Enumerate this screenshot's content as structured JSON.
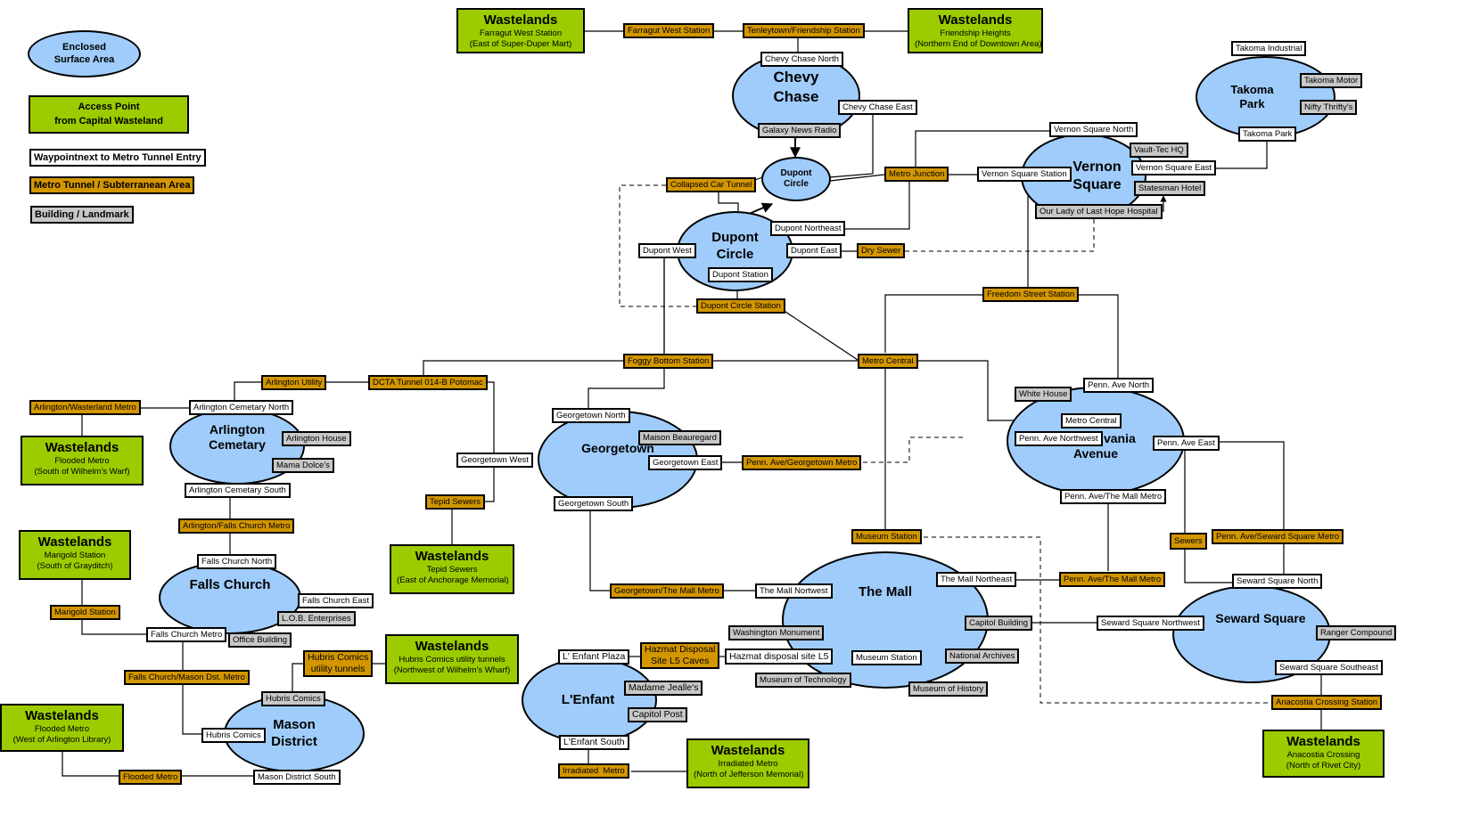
{
  "legend": {
    "enclosed": "Enclosed\nSurface Area",
    "access_title": "Access Point",
    "access_sub": "from Capital Wasteland",
    "waypoint": "Waypointnext to Metro Tunnel Entry",
    "metro": "Metro Tunnel / Subterranean Area",
    "building": "Building / Landmark"
  },
  "colors": {
    "enclosed_area": "#9fccfa",
    "access_point": "#9ccc00",
    "waypoint": "#ffffff",
    "metro_tunnel": "#d39600",
    "building": "#c8c8c8"
  },
  "areas": {
    "chevy_chase": "Chevy\nChase",
    "dupont_small": "Dupont\nCircle",
    "dupont": "Dupont\nCircle",
    "vernon": "Vernon\nSquare",
    "takoma": "Takoma\nPark",
    "arlington": "Arlington\nCemetary",
    "georgetown": "Georgetown",
    "penn": "Pennsylvania\nAvenue",
    "falls": "Falls Church",
    "mall": "The Mall",
    "mason": "Mason\nDistrict",
    "lenfant": "L'Enfant",
    "seward": "Seward Square"
  },
  "wastelands": {
    "farragut": {
      "title": "Wastelands",
      "line1": "Farragut West Station",
      "line2": "(East of Super-Duper Mart)"
    },
    "friendship": {
      "title": "Wastelands",
      "line1": "Friendship Heights",
      "line2": "(Northern End of Downtown Area)"
    },
    "flooded_arl": {
      "title": "Wastelands",
      "line1": "Flooded Metro",
      "line2": "(South of Wilhelm's Warf)"
    },
    "marigold": {
      "title": "Wastelands",
      "line1": "Marigold Station",
      "line2": "(South of Grayditch)"
    },
    "tepid": {
      "title": "Wastelands",
      "line1": "Tepid Sewers",
      "line2": "(East of Anchorage Memorial)"
    },
    "hubris": {
      "title": "Wastelands",
      "line1": "Hubris Comics utility tunnels",
      "line2": "(Northwest of Wilhelm's Wharf)"
    },
    "flooded_lib": {
      "title": "Wastelands",
      "line1": "Flooded Metro",
      "line2": "(West of Arlington Library)"
    },
    "irradiated": {
      "title": "Wastelands",
      "line1": "Irradiated Metro",
      "line2": "(North of Jefferson Memorial)"
    },
    "anacostia": {
      "title": "Wastelands",
      "line1": "Anacostia Crossing",
      "line2": "(North of Rivet City)"
    }
  },
  "metro": {
    "farragut_west": "Farragut West Station",
    "tenleytown": "Tenleytown/Friendship Station",
    "collapsed": "Collapsed Car Tunnel",
    "metro_junction": "Metro Junction",
    "dry_sewer": "Dry Sewer",
    "dupont_station": "Dupont Circle Station",
    "freedom": "Freedom Street Station",
    "foggy": "Foggy Bottom Station",
    "metro_central": "Metro Central",
    "arl_utility": "Arlington Utility",
    "dcta": "DCTA Tunnel 014-B Potomac",
    "arl_wast": "Arlington/Wasterland Metro",
    "tepid_sewers": "Tepid Sewers",
    "penn_georgetown": "Penn. Ave/Georgetown Metro",
    "arl_falls": "Arlington/Falls Church Metro",
    "marigold_station": "Marigold Station",
    "museum_station": "Museum Station",
    "georgetown_mall": "Georgetown/The Mall Metro",
    "penn_mall": "Penn. Ave/The Mall Metro",
    "sewers": "Sewers",
    "penn_seward": "Penn. Ave/Seward Square Metro",
    "hubris_tunnels": "Hubris Comics\nutility tunnels",
    "falls_mason": "Falls Church/Mason Dst. Metro",
    "hazmat_caves": "Hazmat Disposal\nSite L5 Caves",
    "flooded_metro": "Flooded Metro",
    "irradiated_metro": "Irradiated  Metro",
    "anacostia_station": "Anacostia Crossing Station"
  },
  "waypoints": {
    "cc_north": "Chevy Chase North",
    "cc_east": "Chevy Chase East",
    "dupont_northeast": "Dupont Northeast",
    "dupont_west": "Dupont West",
    "dupont_east": "Dupont East",
    "dupont_station": "Dupont Station",
    "vs_north": "Vernon Square North",
    "vs_station": "Vernon Square Station",
    "vs_east": "Vernon Square East",
    "takoma_industrial": "Takoma  Industrial",
    "takoma_park": "Takoma  Park",
    "arl_north": "Arlington Cemetary North",
    "arl_south": "Arlington Cemetary South",
    "gt_north": "Georgetown North",
    "gt_west": "Georgetown West",
    "gt_east": "Georgetown East",
    "gt_south": "Georgetown South",
    "penn_north": "Penn. Ave North",
    "penn_metro_central": "Metro Central",
    "penn_northwest": "Penn. Ave Northwest",
    "penn_east": "Penn. Ave East",
    "penn_mall_wp": "Penn. Ave/The Mall Metro",
    "fc_north": "Falls Church North",
    "fc_east": "Falls Church East",
    "fc_metro": "Falls Church Metro",
    "mall_northwest": "The Mall Nortwest",
    "mall_northeast": "The Mall Northeast",
    "mall_museum": "Museum Station",
    "hazmat_site": "Hazmat disposal site L5",
    "lenfant_plaza": "L' Enfant Plaza",
    "lenfant_south": "L'Enfant South",
    "md_hubris": "Hubris Comics",
    "md_south": "Mason District South",
    "ss_north": "Seward Square North",
    "ss_northwest": "Seward Square Northwest",
    "ss_southeast": "Seward Square Southeast"
  },
  "buildings": {
    "galaxy": "Galaxy News Radio",
    "vault_tec": "Vault-Tec HQ",
    "statesman": "Statesman Hotel",
    "last_hope": "Our Lady of Last Hope Hospital",
    "takoma_motor": "Takoma  Motor",
    "nifty": "Nifty  Thrifty's",
    "arl_house": "Arlington  House",
    "mama_dolce": "Mama Dolce's",
    "maison": "Maison Beauregard",
    "white_house": "White House",
    "lob": "L.O.B. Enterprises",
    "office": "Office Building",
    "washington": "Washington Monument",
    "capitol_building": "Capitol Building",
    "archives": "National Archives",
    "tech_museum": "Museum of Technology",
    "history": "Museum of History",
    "md_hubris_comics": "Hubris Comics",
    "jealle": "Madame Jealle's",
    "capitol_post": "Capitol Post",
    "ranger": "Ranger Compound"
  }
}
